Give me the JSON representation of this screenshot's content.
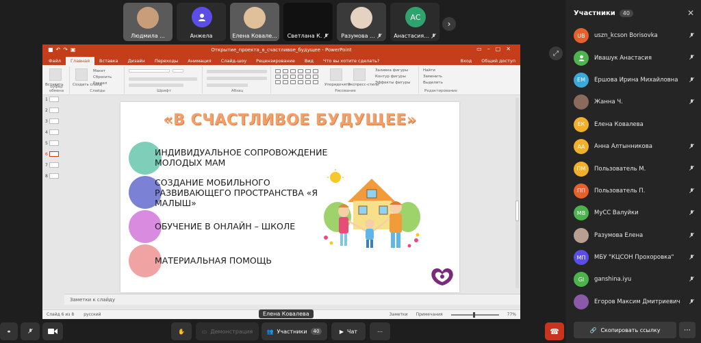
{
  "top_tiles": [
    {
      "name": "Людмила ...",
      "type": "video"
    },
    {
      "name": "Анжела",
      "type": "avatar",
      "color": "#5a4ee6"
    },
    {
      "name": "Елена Ковале...",
      "type": "video"
    },
    {
      "name": "Светлана К.",
      "type": "dark"
    },
    {
      "name": "Разумова ...",
      "type": "video"
    },
    {
      "name": "Анастасия...",
      "type": "avatar",
      "initials": "АС",
      "color": "#2ea36b"
    }
  ],
  "ppt": {
    "window_title": "Открытие_проекта_в_счастливое_будущее - PowerPoint",
    "tabs": [
      "Файл",
      "Главная",
      "Вставка",
      "Дизайн",
      "Переходы",
      "Анимация",
      "Слайд-шоу",
      "Рецензирование",
      "Вид",
      "Что вы хотите сделать?"
    ],
    "tabs_right": [
      "Вход",
      "Общий доступ"
    ],
    "ribbon_groups": {
      "clipboard": "Буфер обмена",
      "slides": "Слайды",
      "font": "Шрифт",
      "paragraph": "Абзац",
      "drawing": "Рисование",
      "editing": "Редактирование"
    },
    "ribbon_items": {
      "paste": "Вставить",
      "new_slide": "Создать слайд",
      "layout": "Макет",
      "reset": "Сбросить",
      "section": "Раздел",
      "arrange": "Упорядочить",
      "quick_styles": "Экспресс-стили",
      "shape_fill": "Заливка фигуры",
      "shape_outline": "Контур фигуры",
      "shape_effects": "Эффекты фигуры",
      "find": "Найти",
      "replace": "Заменить",
      "select": "Выделить"
    },
    "thumbnails": [
      "1",
      "2",
      "3",
      "4",
      "5",
      "6",
      "7",
      "8"
    ],
    "active_thumbnail": "6",
    "notes_placeholder": "Заметки к слайду",
    "status": {
      "slide_info": "Слайд 6 из 8",
      "language": "русский",
      "notes": "Заметки",
      "comments": "Примечания",
      "zoom": "77%"
    }
  },
  "slide": {
    "title": "«В СЧАСТЛИВОЕ БУДУЩЕЕ»",
    "bullets": [
      {
        "text": "ИНДИВИДУАЛЬНОЕ СОПРОВОЖДЕНИЕ МОЛОДЫХ МАМ",
        "color": "#7ecfb9"
      },
      {
        "text": "СОЗДАНИЕ МОБИЛЬНОГО РАЗВИВАЮЩЕГО ПРОСТРАНСТВА «Я МАЛЫШ»",
        "color": "#7b82d6"
      },
      {
        "text": "ОБУЧЕНИЕ В ОНЛАЙН – ШКОЛЕ",
        "color": "#d98be0"
      },
      {
        "text": "МАТЕРИАЛЬНАЯ ПОМОЩЬ",
        "color": "#f0a3a3"
      }
    ]
  },
  "presenter_label": "Елена Ковалева",
  "panel": {
    "title": "Участники",
    "count": "40",
    "participants": [
      {
        "initials": "UB",
        "name": "uszn_kcson Borisovka",
        "color": "#e5602b"
      },
      {
        "initials": "",
        "name": "Ивашук Анастасия",
        "color": "#4db34d",
        "icon": "person-icon"
      },
      {
        "initials": "ЕМ",
        "name": "Ершова Ирина Михайловна",
        "color": "#3aa8d8"
      },
      {
        "initials": "",
        "name": "Жанна Ч.",
        "color": "#8a6a5a",
        "icon": "photo"
      },
      {
        "initials": "ЕК",
        "name": "Елена Ковалева",
        "color": "#f2b02a"
      },
      {
        "initials": "АА",
        "name": "Анна Алтынникова",
        "color": "#f2b02a"
      },
      {
        "initials": "ПМ",
        "name": "Пользователь М.",
        "color": "#f2b02a"
      },
      {
        "initials": "ПП",
        "name": "Пользователь П.",
        "color": "#e5602b"
      },
      {
        "initials": "МВ",
        "name": "МуСС Валуйки",
        "color": "#4db34d"
      },
      {
        "initials": "",
        "name": "Разумова Елена",
        "color": "#b89f8f",
        "icon": "photo"
      },
      {
        "initials": "МП",
        "name": "МБУ \"КЦСОН Прохоровка\"",
        "color": "#5a4ee6"
      },
      {
        "initials": "GI",
        "name": "ganshina.iyu",
        "color": "#4db34d"
      },
      {
        "initials": "",
        "name": "Егоров Максим Дмитриевич",
        "color": "#8a5aa8",
        "icon": "logo"
      }
    ],
    "copy_link": "Скопировать ссылку"
  },
  "toolbar": {
    "demo": "Демонстрация",
    "participants": "Участники",
    "participants_count": "40",
    "chat": "Чат"
  }
}
